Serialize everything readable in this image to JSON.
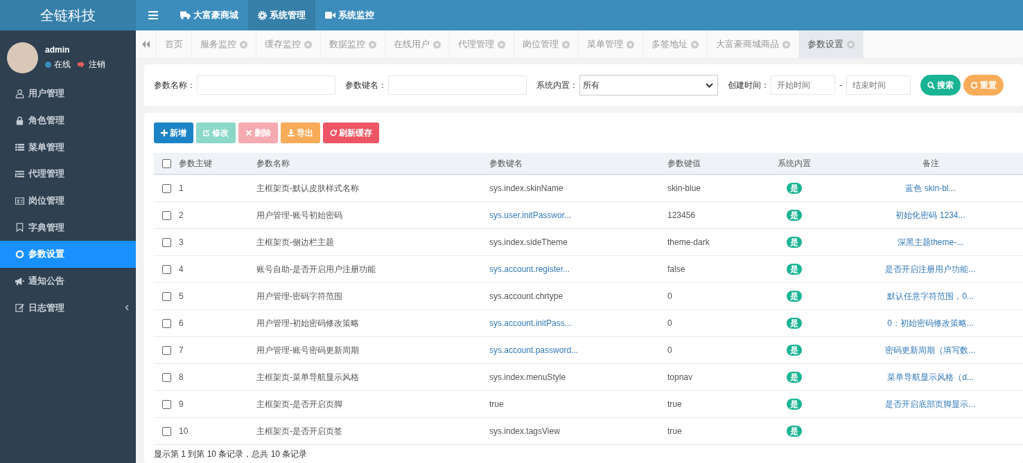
{
  "app": {
    "logo": "全链科技"
  },
  "topnav": [
    {
      "label": "大富豪商城",
      "selected": false
    },
    {
      "label": "系统管理",
      "selected": true
    },
    {
      "label": "系统监控",
      "selected": false
    }
  ],
  "user": {
    "name": "admin",
    "status": "在线",
    "logout": "注销"
  },
  "sidebar": {
    "items": [
      {
        "label": "用户管理",
        "selected": false,
        "expandable": false
      },
      {
        "label": "角色管理",
        "selected": false,
        "expandable": false
      },
      {
        "label": "菜单管理",
        "selected": false,
        "expandable": false
      },
      {
        "label": "代理管理",
        "selected": false,
        "expandable": false
      },
      {
        "label": "岗位管理",
        "selected": false,
        "expandable": false
      },
      {
        "label": "字典管理",
        "selected": false,
        "expandable": false
      },
      {
        "label": "参数设置",
        "selected": true,
        "expandable": false
      },
      {
        "label": "通知公告",
        "selected": false,
        "expandable": false
      },
      {
        "label": "日志管理",
        "selected": false,
        "expandable": true
      }
    ]
  },
  "tabs": [
    {
      "label": "首页",
      "closable": false,
      "selected": false
    },
    {
      "label": "服务监控",
      "closable": true,
      "selected": false
    },
    {
      "label": "缓存监控",
      "closable": true,
      "selected": false
    },
    {
      "label": "数据监控",
      "closable": true,
      "selected": false
    },
    {
      "label": "在线用户",
      "closable": true,
      "selected": false
    },
    {
      "label": "代理管理",
      "closable": true,
      "selected": false
    },
    {
      "label": "岗位管理",
      "closable": true,
      "selected": false
    },
    {
      "label": "菜单管理",
      "closable": true,
      "selected": false
    },
    {
      "label": "多签地址",
      "closable": true,
      "selected": false
    },
    {
      "label": "大富豪商城商品",
      "closable": true,
      "selected": false
    },
    {
      "label": "参数设置",
      "closable": true,
      "selected": true
    }
  ],
  "search": {
    "fields": [
      {
        "label": "参数名称：",
        "kind": "text"
      },
      {
        "label": "参数键名：",
        "kind": "text"
      },
      {
        "label": "系统内置：",
        "kind": "select",
        "value": "所有"
      },
      {
        "label": "创建时间：",
        "kind": "daterange",
        "placeholder": "开始时间",
        "separator": "-",
        "placeholder_end": "结束时间"
      }
    ],
    "buttons": [
      {
        "label": "搜索",
        "kind": "success"
      },
      {
        "label": "重置",
        "kind": "warning"
      }
    ]
  },
  "toolbar": [
    {
      "label": "新增",
      "kind": "primary",
      "disabled": false
    },
    {
      "label": "修改",
      "kind": "success",
      "disabled": true
    },
    {
      "label": "删除",
      "kind": "danger",
      "disabled": true
    },
    {
      "label": "导出",
      "kind": "warning",
      "disabled": false
    },
    {
      "label": "刷新缓存",
      "kind": "danger",
      "disabled": false
    }
  ],
  "table": {
    "all_checked": false,
    "columns": [
      "参数主键",
      "参数名称",
      "参数键名",
      "参数键值",
      "系统内置",
      "备注"
    ],
    "rows": [
      {
        "id": "1",
        "name": "主框架页-默认皮肤样式名称",
        "key": "sys.index.skinName",
        "key_link": false,
        "value": "skin-blue",
        "builtin": "是",
        "remark": "蓝色 skin-bl...",
        "checked": false
      },
      {
        "id": "2",
        "name": "用户管理-账号初始密码",
        "key": "sys.user.initPasswor...",
        "key_link": true,
        "value": "123456",
        "builtin": "是",
        "remark": "初始化密码 1234...",
        "checked": false
      },
      {
        "id": "3",
        "name": "主框架页-侧边栏主题",
        "key": "sys.index.sideTheme",
        "key_link": false,
        "value": "theme-dark",
        "builtin": "是",
        "remark": "深黑主题theme-...",
        "checked": false
      },
      {
        "id": "4",
        "name": "账号自助-是否开启用户注册功能",
        "key": "sys.account.register...",
        "key_link": true,
        "value": "false",
        "builtin": "是",
        "remark": "是否开启注册用户功能...",
        "checked": false
      },
      {
        "id": "5",
        "name": "用户管理-密码字符范围",
        "key": "sys.account.chrtype",
        "key_link": false,
        "value": "0",
        "builtin": "是",
        "remark": "默认任意字符范围，0...",
        "checked": false
      },
      {
        "id": "6",
        "name": "用户管理-初始密码修改策略",
        "key": "sys.account.initPass...",
        "key_link": true,
        "value": "0",
        "builtin": "是",
        "remark": "0：初始密码修改策略...",
        "checked": false
      },
      {
        "id": "7",
        "name": "用户管理-账号密码更新周期",
        "key": "sys.account.password...",
        "key_link": true,
        "value": "0",
        "builtin": "是",
        "remark": "密码更新周期（填写数...",
        "checked": false
      },
      {
        "id": "8",
        "name": "主框架页-菜单导航显示风格",
        "key": "sys.index.menuStyle",
        "key_link": false,
        "value": "topnav",
        "builtin": "是",
        "remark": "菜单导航显示风格（d...",
        "checked": false
      },
      {
        "id": "9",
        "name": "主框架页-是否开启页脚",
        "key": "true",
        "key_link": false,
        "value": "true",
        "builtin": "是",
        "remark": "是否开启底部页脚显示...",
        "checked": false
      },
      {
        "id": "10",
        "name": "主框架页-是否开启页签",
        "key": "sys.index.tagsView",
        "key_link": false,
        "value": "true",
        "builtin": "是",
        "remark": "",
        "checked": false
      }
    ]
  },
  "pagination": {
    "summary": "显示第 1 到第 10 条记录，总共 10 条记录"
  }
}
